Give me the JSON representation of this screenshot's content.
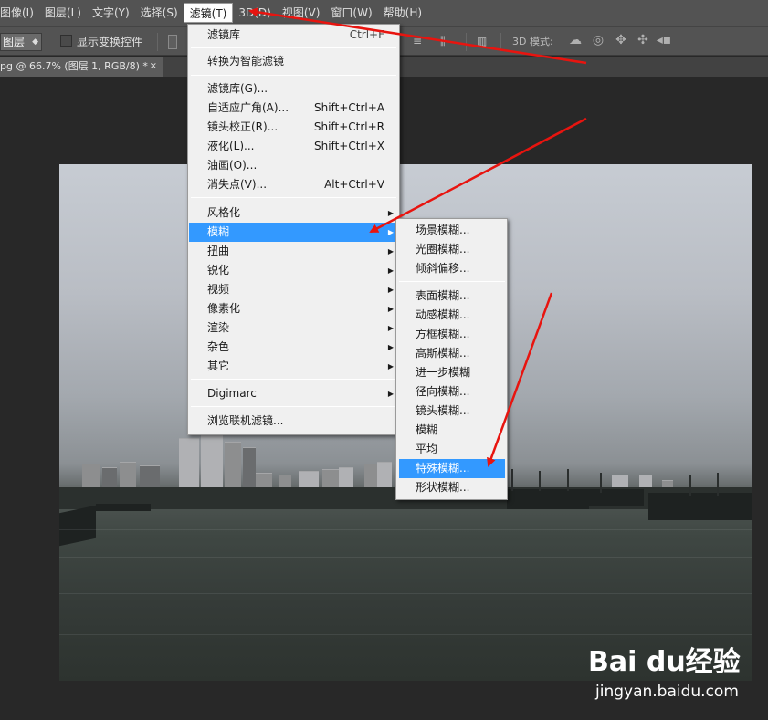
{
  "menubar": {
    "items": [
      "图像(I)",
      "图层(L)",
      "文字(Y)",
      "选择(S)",
      "滤镜(T)",
      "3D(D)",
      "视图(V)",
      "窗口(W)",
      "帮助(H)"
    ]
  },
  "options": {
    "layer_select": "图层",
    "show_transform": "显示变换控件",
    "label_3d": "3D 模式:"
  },
  "document": {
    "tab_title": "pg @ 66.7% (图层 1, RGB/8) *",
    "close": "×"
  },
  "filter_menu": {
    "items": [
      {
        "label": "滤镜库",
        "shortcut": "Ctrl+F"
      },
      {
        "label": "转换为智能滤镜"
      },
      {
        "label": "滤镜库(G)..."
      },
      {
        "label": "自适应广角(A)...",
        "shortcut": "Shift+Ctrl+A"
      },
      {
        "label": "镜头校正(R)...",
        "shortcut": "Shift+Ctrl+R"
      },
      {
        "label": "液化(L)...",
        "shortcut": "Shift+Ctrl+X"
      },
      {
        "label": "油画(O)..."
      },
      {
        "label": "消失点(V)...",
        "shortcut": "Alt+Ctrl+V"
      },
      {
        "label": "风格化"
      },
      {
        "label": "模糊"
      },
      {
        "label": "扭曲"
      },
      {
        "label": "锐化"
      },
      {
        "label": "视频"
      },
      {
        "label": "像素化"
      },
      {
        "label": "渲染"
      },
      {
        "label": "杂色"
      },
      {
        "label": "其它"
      },
      {
        "label": "Digimarc"
      },
      {
        "label": "浏览联机滤镜..."
      }
    ],
    "submenu_arrow": "▶"
  },
  "blur_submenu": {
    "items": [
      "场景模糊...",
      "光圈模糊...",
      "倾斜偏移...",
      "表面模糊...",
      "动感模糊...",
      "方框模糊...",
      "高斯模糊...",
      "进一步模糊",
      "径向模糊...",
      "镜头模糊...",
      "模糊",
      "平均",
      "特殊模糊...",
      "形状模糊..."
    ]
  },
  "watermark": {
    "main": "Bai du经验",
    "sub": "jingyan.baidu.com"
  },
  "colors": {
    "highlight": "#3399ff",
    "annotation_arrow": "#e8140f"
  }
}
